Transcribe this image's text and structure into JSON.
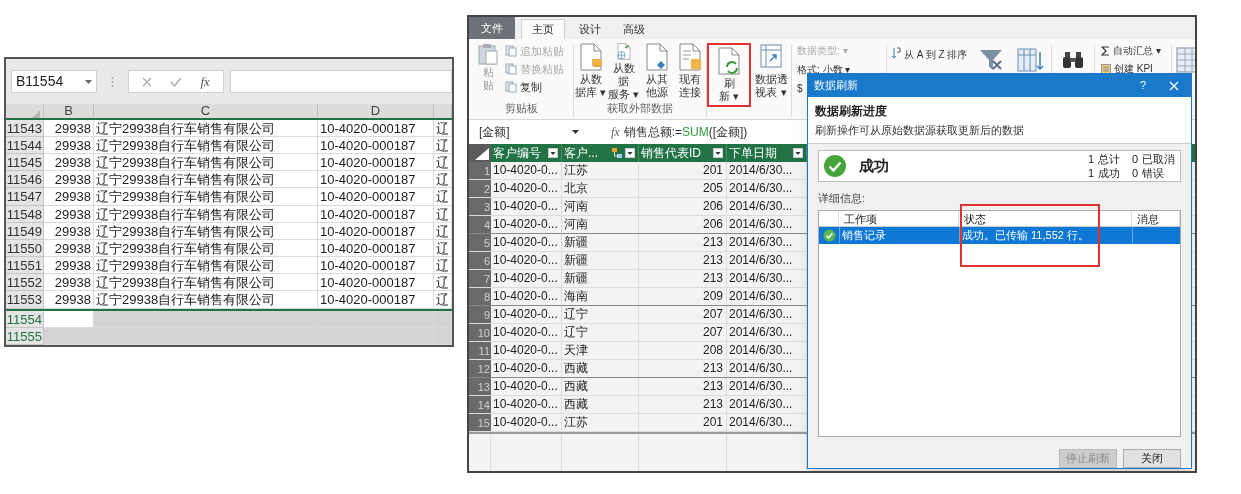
{
  "excel": {
    "name_box": "B11554",
    "fx": "fx",
    "columns": [
      "B",
      "C",
      "D"
    ],
    "rows": [
      {
        "number": "11543",
        "selected": false,
        "cells": [
          "29938",
          "辽宁29938自行车销售有限公司",
          "10-4020-000187",
          "辽"
        ]
      },
      {
        "number": "11544",
        "selected": false,
        "cells": [
          "29938",
          "辽宁29938自行车销售有限公司",
          "10-4020-000187",
          "辽"
        ]
      },
      {
        "number": "11545",
        "selected": false,
        "cells": [
          "29938",
          "辽宁29938自行车销售有限公司",
          "10-4020-000187",
          "辽"
        ]
      },
      {
        "number": "11546",
        "selected": false,
        "cells": [
          "29938",
          "辽宁29938自行车销售有限公司",
          "10-4020-000187",
          "辽"
        ]
      },
      {
        "number": "11547",
        "selected": false,
        "cells": [
          "29938",
          "辽宁29938自行车销售有限公司",
          "10-4020-000187",
          "辽"
        ]
      },
      {
        "number": "11548",
        "selected": false,
        "cells": [
          "29938",
          "辽宁29938自行车销售有限公司",
          "10-4020-000187",
          "辽"
        ]
      },
      {
        "number": "11549",
        "selected": false,
        "cells": [
          "29938",
          "辽宁29938自行车销售有限公司",
          "10-4020-000187",
          "辽"
        ]
      },
      {
        "number": "11550",
        "selected": false,
        "cells": [
          "29938",
          "辽宁29938自行车销售有限公司",
          "10-4020-000187",
          "辽"
        ]
      },
      {
        "number": "11551",
        "selected": false,
        "cells": [
          "29938",
          "辽宁29938自行车销售有限公司",
          "10-4020-000187",
          "辽"
        ]
      },
      {
        "number": "11552",
        "selected": false,
        "cells": [
          "29938",
          "辽宁29938自行车销售有限公司",
          "10-4020-000187",
          "辽"
        ]
      },
      {
        "number": "11553",
        "selected": false,
        "cells": [
          "29938",
          "辽宁29938自行车销售有限公司",
          "10-4020-000187",
          "辽"
        ]
      },
      {
        "number": "11554",
        "selected": true,
        "cells": []
      },
      {
        "number": "11555",
        "selected": true,
        "cells": []
      }
    ]
  },
  "power_pivot": {
    "tabs": [
      {
        "label": "文件",
        "kind": "file",
        "selected": false
      },
      {
        "label": "主页",
        "kind": "tab",
        "selected": true
      },
      {
        "label": "设计",
        "kind": "tab",
        "selected": false
      },
      {
        "label": "高级",
        "kind": "tab",
        "selected": false
      }
    ],
    "ribbon": {
      "paste": {
        "lines": [
          "粘",
          "贴"
        ]
      },
      "clipboard_items": [
        {
          "label": "追加粘贴",
          "disabled": true
        },
        {
          "label": "替换粘贴",
          "disabled": true
        },
        {
          "label": "复制",
          "disabled": false
        }
      ],
      "clipboard_label": "剪贴板",
      "external_sources": [
        {
          "lines": [
            "从数",
            "据库 ▾"
          ]
        },
        {
          "lines": [
            "从数据",
            "服务 ▾"
          ]
        },
        {
          "lines": [
            "从其",
            "他源"
          ]
        },
        {
          "lines": [
            "现有",
            "连接"
          ]
        }
      ],
      "external_label": "获取外部数据",
      "refresh": {
        "lines": [
          "刷",
          "新 ▾"
        ],
        "highlighted": true
      },
      "pivot": {
        "lines": [
          "数据透",
          "视表 ▾"
        ]
      },
      "data_type": "数据类型: ▾",
      "format": "格式: 小数 ▾",
      "currency": "$",
      "sort": "从 A 到 Z 排序",
      "autosum": "自动汇总 ▾",
      "create_kpi": "创建 KPI"
    },
    "formula_bar": {
      "name_box": "[金额]",
      "fx": "fx",
      "measure": "销售总额:=",
      "function": "SUM",
      "argument": "([金额])"
    },
    "grid": {
      "columns": [
        {
          "label": "客户编号",
          "kind": "plain"
        },
        {
          "label": "客户...",
          "kind": "related"
        },
        {
          "label": "销售代表ID",
          "kind": "plain"
        },
        {
          "label": "下单日期",
          "kind": "plain"
        }
      ],
      "rows": [
        {
          "number": "1",
          "cells": [
            "10-4020-0...",
            "江苏",
            "201",
            "2014/6/30..."
          ]
        },
        {
          "number": "2",
          "cells": [
            "10-4020-0...",
            "北京",
            "205",
            "2014/6/30..."
          ]
        },
        {
          "number": "3",
          "cells": [
            "10-4020-0...",
            "河南",
            "206",
            "2014/6/30..."
          ]
        },
        {
          "number": "4",
          "cells": [
            "10-4020-0...",
            "河南",
            "206",
            "2014/6/30..."
          ]
        },
        {
          "number": "5",
          "cells": [
            "10-4020-0...",
            "新疆",
            "213",
            "2014/6/30..."
          ]
        },
        {
          "number": "6",
          "cells": [
            "10-4020-0...",
            "新疆",
            "213",
            "2014/6/30..."
          ]
        },
        {
          "number": "7",
          "cells": [
            "10-4020-0...",
            "新疆",
            "213",
            "2014/6/30..."
          ]
        },
        {
          "number": "8",
          "cells": [
            "10-4020-0...",
            "海南",
            "209",
            "2014/6/30..."
          ]
        },
        {
          "number": "9",
          "cells": [
            "10-4020-0...",
            "辽宁",
            "207",
            "2014/6/30..."
          ]
        },
        {
          "number": "10",
          "cells": [
            "10-4020-0...",
            "辽宁",
            "207",
            "2014/6/30..."
          ]
        },
        {
          "number": "11",
          "cells": [
            "10-4020-0...",
            "天津",
            "208",
            "2014/6/30..."
          ]
        },
        {
          "number": "12",
          "cells": [
            "10-4020-0...",
            "西藏",
            "213",
            "2014/6/30..."
          ]
        },
        {
          "number": "13",
          "cells": [
            "10-4020-0...",
            "西藏",
            "213",
            "2014/6/30..."
          ]
        },
        {
          "number": "14",
          "cells": [
            "10-4020-0...",
            "西藏",
            "213",
            "2014/6/30..."
          ]
        },
        {
          "number": "15",
          "cells": [
            "10-4020-0...",
            "江苏",
            "201",
            "2014/6/30..."
          ]
        }
      ]
    }
  },
  "dialog": {
    "title": "数据刷新",
    "help": "?",
    "heading": "数据刷新进度",
    "description": "刷新操作可从原始数据源获取更新后的数据",
    "result": "成功",
    "stats": [
      {
        "count": "1",
        "label": "总计"
      },
      {
        "count": "0",
        "label": "已取消"
      },
      {
        "count": "1",
        "label": "成功"
      },
      {
        "count": "0",
        "label": "错误"
      }
    ],
    "details_label": "详细信息:",
    "columns": [
      "工作项",
      "状态",
      "消息"
    ],
    "status_column_highlighted": true,
    "items": [
      {
        "name": "销售记录",
        "status": "成功。已传输 11,552 行。",
        "selected": true
      }
    ],
    "buttons": [
      {
        "label": "停止刷新",
        "disabled": true
      },
      {
        "label": "关闭",
        "disabled": false
      }
    ]
  }
}
